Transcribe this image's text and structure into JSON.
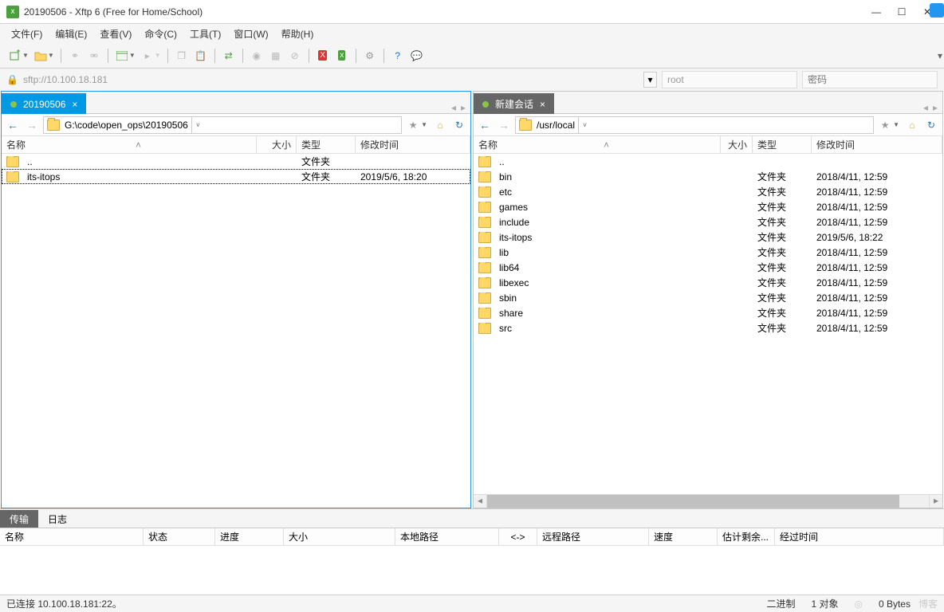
{
  "window": {
    "title": "20190506 - Xftp 6 (Free for Home/School)"
  },
  "menu": {
    "file": "文件(F)",
    "edit": "编辑(E)",
    "view": "查看(V)",
    "command": "命令(C)",
    "tools": "工具(T)",
    "window": "窗口(W)",
    "help": "帮助(H)"
  },
  "address": {
    "url": "sftp://10.100.18.181",
    "user": "root",
    "passwordPlaceholder": "密码"
  },
  "leftPane": {
    "tab": "20190506",
    "path": "G:\\code\\open_ops\\20190506",
    "cols": {
      "name": "名称",
      "size": "大小",
      "type": "类型",
      "mtime": "修改时间"
    },
    "rows": [
      {
        "name": "..",
        "size": "",
        "type": "文件夹",
        "mtime": ""
      },
      {
        "name": "its-itops",
        "size": "",
        "type": "文件夹",
        "mtime": "2019/5/6, 18:20",
        "selected": true
      }
    ]
  },
  "rightPane": {
    "tab": "新建会话",
    "path": "/usr/local",
    "cols": {
      "name": "名称",
      "size": "大小",
      "type": "类型",
      "mtime": "修改时间"
    },
    "rows": [
      {
        "name": "..",
        "size": "",
        "type": "",
        "mtime": ""
      },
      {
        "name": "bin",
        "size": "",
        "type": "文件夹",
        "mtime": "2018/4/11, 12:59"
      },
      {
        "name": "etc",
        "size": "",
        "type": "文件夹",
        "mtime": "2018/4/11, 12:59"
      },
      {
        "name": "games",
        "size": "",
        "type": "文件夹",
        "mtime": "2018/4/11, 12:59"
      },
      {
        "name": "include",
        "size": "",
        "type": "文件夹",
        "mtime": "2018/4/11, 12:59"
      },
      {
        "name": "its-itops",
        "size": "",
        "type": "文件夹",
        "mtime": "2019/5/6, 18:22"
      },
      {
        "name": "lib",
        "size": "",
        "type": "文件夹",
        "mtime": "2018/4/11, 12:59"
      },
      {
        "name": "lib64",
        "size": "",
        "type": "文件夹",
        "mtime": "2018/4/11, 12:59"
      },
      {
        "name": "libexec",
        "size": "",
        "type": "文件夹",
        "mtime": "2018/4/11, 12:59"
      },
      {
        "name": "sbin",
        "size": "",
        "type": "文件夹",
        "mtime": "2018/4/11, 12:59"
      },
      {
        "name": "share",
        "size": "",
        "type": "文件夹",
        "mtime": "2018/4/11, 12:59"
      },
      {
        "name": "src",
        "size": "",
        "type": "文件夹",
        "mtime": "2018/4/11, 12:59"
      }
    ]
  },
  "bottom": {
    "tabs": {
      "transfer": "传输",
      "log": "日志"
    },
    "cols": {
      "name": "名称",
      "status": "状态",
      "progress": "进度",
      "size": "大小",
      "localPath": "本地路径",
      "arrow": "<->",
      "remotePath": "远程路径",
      "speed": "速度",
      "eta": "估计剩余...",
      "elapsed": "经过时间"
    }
  },
  "status": {
    "left": "已连接 10.100.18.181:22。",
    "mode": "二进制",
    "objects": "1 对象",
    "bytes": "0 Bytes",
    "watermark": "博客"
  }
}
